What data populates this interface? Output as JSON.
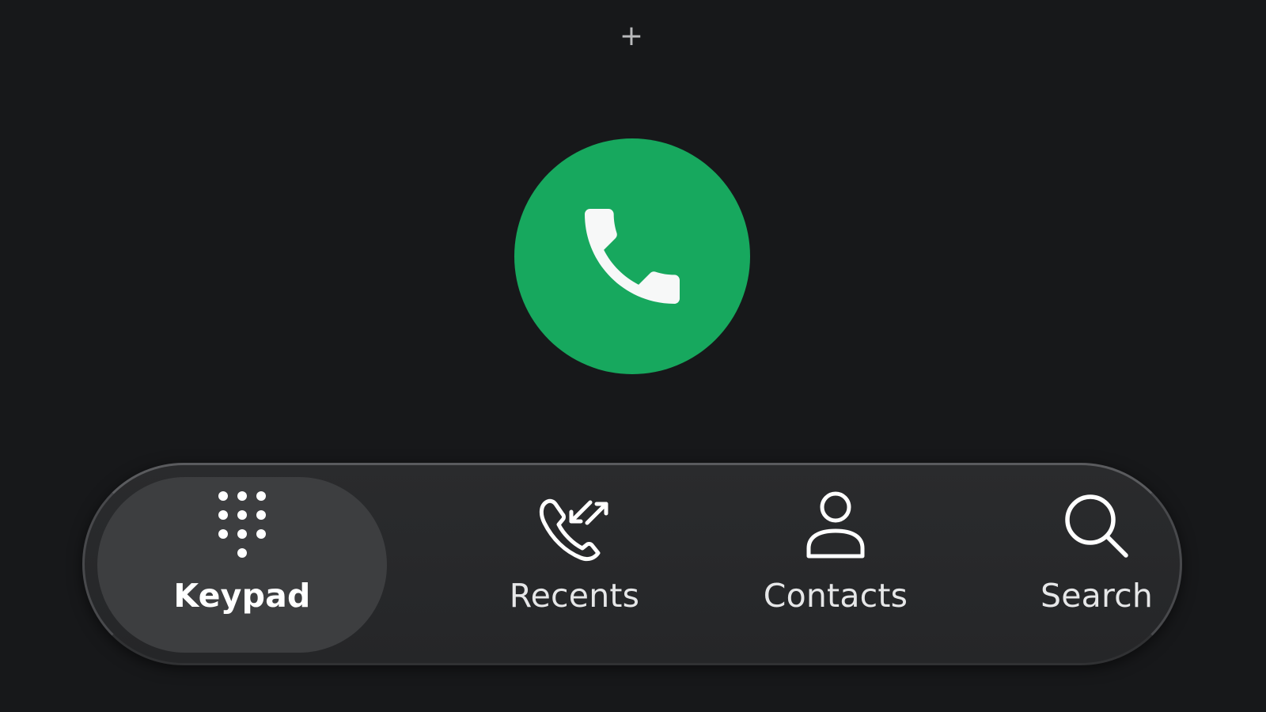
{
  "top_action": {
    "label": "+",
    "icon": "plus-icon"
  },
  "call_button": {
    "icon": "phone-icon",
    "color": "#17a85e"
  },
  "bottom_nav": {
    "active_index": 0,
    "items": [
      {
        "label": "Keypad",
        "icon": "dialpad-icon"
      },
      {
        "label": "Recents",
        "icon": "recent-calls-icon"
      },
      {
        "label": "Contacts",
        "icon": "person-icon"
      },
      {
        "label": "Search",
        "icon": "search-icon"
      }
    ]
  },
  "colors": {
    "background": "#17181a",
    "nav_bar": "#27282a",
    "active_pill": "#3d3e40",
    "text": "#e6e7e8"
  }
}
